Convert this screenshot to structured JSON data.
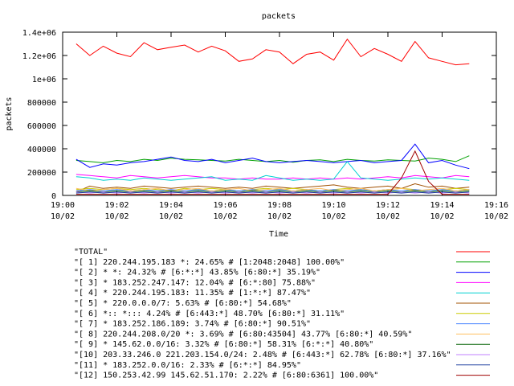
{
  "chart_data": {
    "type": "line",
    "title": "packets",
    "xlabel": "Time",
    "ylabel": "packets",
    "ylim": [
      0,
      1400000
    ],
    "xlim": [
      "10/02 19:00",
      "10/02 19:16"
    ],
    "grid": false,
    "legend_position": "below",
    "y_ticks": [
      {
        "value": 0,
        "label": "0"
      },
      {
        "value": 200000,
        "label": "200000"
      },
      {
        "value": 400000,
        "label": "400000"
      },
      {
        "value": 600000,
        "label": "600000"
      },
      {
        "value": 800000,
        "label": "800000"
      },
      {
        "value": 1000000,
        "label": "1e+06"
      },
      {
        "value": 1200000,
        "label": "1.2e+06"
      },
      {
        "value": 1400000,
        "label": "1.4e+06"
      }
    ],
    "x_ticks": [
      {
        "value": "10/02 19:00",
        "time": "19:00",
        "date": "10/02"
      },
      {
        "value": "10/02 19:02",
        "time": "19:02",
        "date": "10/02"
      },
      {
        "value": "10/02 19:04",
        "time": "19:04",
        "date": "10/02"
      },
      {
        "value": "10/02 19:06",
        "time": "19:06",
        "date": "10/02"
      },
      {
        "value": "10/02 19:08",
        "time": "19:08",
        "date": "10/02"
      },
      {
        "value": "10/02 19:10",
        "time": "19:10",
        "date": "10/02"
      },
      {
        "value": "10/02 19:12",
        "time": "19:12",
        "date": "10/02"
      },
      {
        "value": "10/02 19:14",
        "time": "19:14",
        "date": "10/02"
      },
      {
        "value": "10/02 19:16",
        "time": "19:16",
        "date": "10/02"
      }
    ],
    "x": [
      "10/02 19:00:30",
      "10/02 19:01:00",
      "10/02 19:01:30",
      "10/02 19:02:00",
      "10/02 19:02:30",
      "10/02 19:03:00",
      "10/02 19:03:30",
      "10/02 19:04:00",
      "10/02 19:04:30",
      "10/02 19:05:00",
      "10/02 19:05:30",
      "10/02 19:06:00",
      "10/02 19:06:30",
      "10/02 19:07:00",
      "10/02 19:07:30",
      "10/02 19:08:00",
      "10/02 19:08:30",
      "10/02 19:09:00",
      "10/02 19:09:30",
      "10/02 19:10:00",
      "10/02 19:10:30",
      "10/02 19:11:00",
      "10/02 19:11:30",
      "10/02 19:12:00",
      "10/02 19:12:30",
      "10/02 19:13:00",
      "10/02 19:13:30",
      "10/02 19:14:00",
      "10/02 19:14:30",
      "10/02 19:15:00"
    ],
    "series": [
      {
        "name": "\"TOTAL\"",
        "color": "#ff0000",
        "values": [
          1300000,
          1200000,
          1280000,
          1220000,
          1190000,
          1310000,
          1250000,
          1270000,
          1290000,
          1230000,
          1280000,
          1240000,
          1150000,
          1170000,
          1250000,
          1230000,
          1130000,
          1210000,
          1230000,
          1160000,
          1340000,
          1190000,
          1260000,
          1210000,
          1150000,
          1320000,
          1180000,
          1150000,
          1120000,
          1130000
        ]
      },
      {
        "name": "\"[ 1] 220.244.195.183 *: 24.65% # [1:2048:2048] 100.00%\"",
        "color": "#00a000",
        "values": [
          300000,
          290000,
          280000,
          300000,
          290000,
          310000,
          300000,
          320000,
          310000,
          305000,
          300000,
          295000,
          310000,
          300000,
          290000,
          300000,
          285000,
          300000,
          305000,
          290000,
          310000,
          300000,
          295000,
          305000,
          300000,
          295000,
          320000,
          310000,
          290000,
          340000
        ]
      },
      {
        "name": "\"[ 2] * *: 24.32% # [6:*:*] 43.85% [6:80:*] 35.19%\"",
        "color": "#0000ff",
        "values": [
          310000,
          240000,
          270000,
          260000,
          280000,
          290000,
          310000,
          330000,
          300000,
          290000,
          310000,
          280000,
          300000,
          320000,
          290000,
          280000,
          290000,
          300000,
          290000,
          280000,
          290000,
          300000,
          280000,
          290000,
          300000,
          440000,
          280000,
          300000,
          260000,
          230000
        ]
      },
      {
        "name": "\"[ 3] * 183.252.247.147: 12.04% # [6:*:80] 75.88%\"",
        "color": "#ff00ff",
        "values": [
          180000,
          170000,
          160000,
          150000,
          170000,
          160000,
          150000,
          160000,
          170000,
          160000,
          150000,
          150000,
          140000,
          150000,
          140000,
          140000,
          150000,
          140000,
          150000,
          140000,
          150000,
          140000,
          150000,
          160000,
          150000,
          170000,
          160000,
          150000,
          170000,
          160000
        ]
      },
      {
        "name": "\"[ 4] * 220.244.195.183: 11.35% # [1:*:*] 87.47%\"",
        "color": "#00d0d0",
        "values": [
          160000,
          150000,
          130000,
          140000,
          130000,
          150000,
          140000,
          130000,
          140000,
          150000,
          160000,
          130000,
          140000,
          130000,
          170000,
          150000,
          130000,
          140000,
          130000,
          140000,
          290000,
          150000,
          140000,
          130000,
          140000,
          150000,
          140000,
          150000,
          140000,
          130000
        ]
      },
      {
        "name": "\"[ 5] * 220.0.0.0/7: 5.63% # [6:80:*] 54.68%\"",
        "color": "#a05000",
        "values": [
          30000,
          80000,
          60000,
          70000,
          60000,
          80000,
          70000,
          60000,
          70000,
          80000,
          70000,
          60000,
          70000,
          60000,
          80000,
          70000,
          60000,
          70000,
          80000,
          90000,
          70000,
          60000,
          70000,
          80000,
          60000,
          100000,
          70000,
          80000,
          60000,
          70000
        ]
      },
      {
        "name": "\"[ 6] *:: *::: 4.24% # [6:443:*] 48.70% [6:80:*] 31.11%\"",
        "color": "#cccc00",
        "values": [
          50000,
          60000,
          50000,
          60000,
          50000,
          60000,
          50000,
          40000,
          60000,
          50000,
          60000,
          50000,
          40000,
          50000,
          60000,
          50000,
          60000,
          50000,
          40000,
          50000,
          60000,
          50000,
          40000,
          50000,
          60000,
          50000,
          40000,
          50000,
          60000,
          50000
        ]
      },
      {
        "name": "\"[ 7] * 183.252.186.189: 3.74% # [6:80:*] 90.51%\"",
        "color": "#4080ff",
        "values": [
          40000,
          50000,
          40000,
          50000,
          40000,
          50000,
          40000,
          50000,
          40000,
          50000,
          40000,
          50000,
          40000,
          50000,
          40000,
          50000,
          40000,
          50000,
          40000,
          50000,
          40000,
          50000,
          40000,
          50000,
          40000,
          50000,
          40000,
          50000,
          40000,
          50000
        ]
      },
      {
        "name": "\"[ 8] 220.244.208.0/20 *: 3.69% # [6:80:43504] 43.77% [6:80:*] 40.59%\"",
        "color": "#ffc060",
        "values": [
          60000,
          40000,
          50000,
          60000,
          40000,
          50000,
          60000,
          40000,
          50000,
          60000,
          40000,
          50000,
          60000,
          40000,
          50000,
          60000,
          40000,
          50000,
          60000,
          40000,
          50000,
          60000,
          40000,
          50000,
          60000,
          40000,
          50000,
          60000,
          40000,
          50000
        ]
      },
      {
        "name": "\"[ 9] * 145.62.0.0/16: 3.32% # [6:80:*] 58.31% [6:*:*] 40.80%\"",
        "color": "#006000",
        "values": [
          30000,
          40000,
          30000,
          40000,
          30000,
          40000,
          30000,
          40000,
          30000,
          40000,
          30000,
          40000,
          30000,
          40000,
          30000,
          40000,
          30000,
          40000,
          30000,
          40000,
          30000,
          40000,
          30000,
          40000,
          30000,
          40000,
          30000,
          40000,
          30000,
          40000
        ]
      },
      {
        "name": "\"[10] 203.33.246.0 221.203.154.0/24: 2.48% # [6:443:*] 62.78% [6:80:*] 37.16%\"",
        "color": "#c080ff",
        "values": [
          30000,
          20000,
          30000,
          20000,
          30000,
          20000,
          30000,
          20000,
          30000,
          20000,
          30000,
          20000,
          30000,
          20000,
          30000,
          20000,
          30000,
          20000,
          30000,
          20000,
          30000,
          20000,
          30000,
          20000,
          30000,
          20000,
          30000,
          20000,
          30000,
          20000
        ]
      },
      {
        "name": "\"[11] * 183.252.0.0/16: 2.33% # [6:*:*] 84.95%\"",
        "color": "#2040a0",
        "values": [
          20000,
          30000,
          20000,
          30000,
          20000,
          30000,
          20000,
          30000,
          20000,
          30000,
          20000,
          30000,
          20000,
          30000,
          20000,
          30000,
          20000,
          30000,
          20000,
          30000,
          20000,
          30000,
          20000,
          30000,
          20000,
          30000,
          20000,
          30000,
          20000,
          30000
        ]
      },
      {
        "name": "\"[12] 150.253.42.99 145.62.51.170: 2.22% # [6:80:6361] 100.00%\"",
        "color": "#a00000",
        "values": [
          10000,
          10000,
          10000,
          10000,
          10000,
          10000,
          10000,
          10000,
          10000,
          10000,
          10000,
          10000,
          10000,
          10000,
          10000,
          10000,
          10000,
          10000,
          10000,
          10000,
          10000,
          10000,
          10000,
          10000,
          150000,
          380000,
          120000,
          10000,
          10000,
          10000
        ]
      }
    ]
  }
}
